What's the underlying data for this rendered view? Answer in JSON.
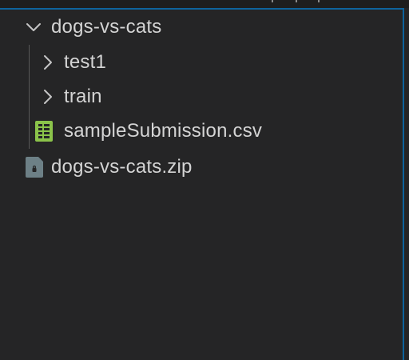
{
  "explorer": {
    "root_folder": {
      "label": "dogs-vs-cats",
      "icon": "chevron-down-icon",
      "children": [
        {
          "label": "test1",
          "type": "folder",
          "icon": "chevron-right-icon"
        },
        {
          "label": "train",
          "type": "folder",
          "icon": "chevron-right-icon"
        },
        {
          "label": "sampleSubmission.csv",
          "type": "file",
          "icon": "csv-file-icon",
          "icon_color": "#8bc34a"
        }
      ]
    },
    "zip_file": {
      "label": "dogs-vs-cats.zip",
      "icon": "zip-file-icon",
      "icon_color": "#6d8086"
    }
  },
  "colors": {
    "background": "#252526",
    "text": "#d4d4d4",
    "focus_border": "#0e639c"
  }
}
